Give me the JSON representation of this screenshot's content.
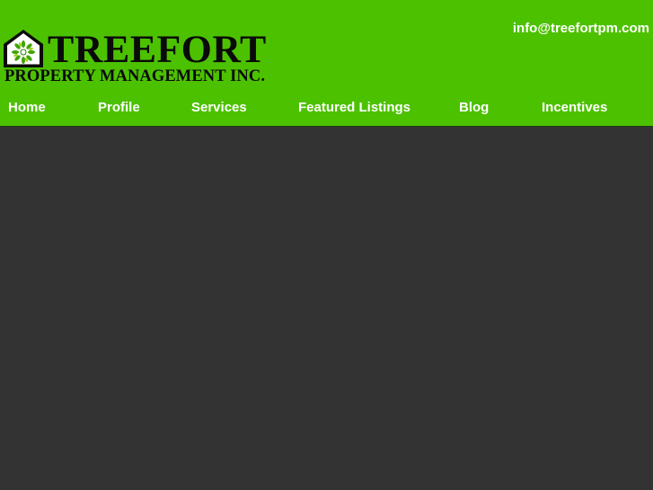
{
  "header": {
    "email": "info@treefortpm.com",
    "logo": {
      "title": "TREEFORT",
      "subtitle": "PROPERTY MANAGEMENT INC.",
      "icon": "house-tree-icon"
    }
  },
  "nav": {
    "items": [
      {
        "label": "Home"
      },
      {
        "label": "Profile"
      },
      {
        "label": "Services"
      },
      {
        "label": "Featured Listings"
      },
      {
        "label": "Blog"
      },
      {
        "label": "Incentives"
      }
    ]
  },
  "colors": {
    "header_bg": "#4cc100",
    "content_bg": "#333333",
    "nav_text": "#ffffff",
    "logo_text": "#0a0a0a"
  }
}
